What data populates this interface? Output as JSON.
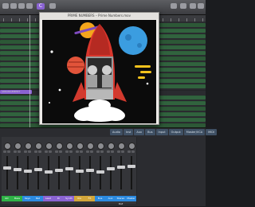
{
  "app": {
    "toolbar_badge": "C"
  },
  "arrange": {
    "tracks": [
      "",
      "",
      "",
      "",
      "",
      "",
      "",
      "",
      "",
      "",
      "",
      "",
      "",
      "",
      "",
      "",
      "",
      "",
      ""
    ],
    "highlight_track_label": "ARRANGEMENT"
  },
  "art_window": {
    "title": "PRIME NUMBERS – Prime Numbers.mov"
  },
  "mixer": {
    "tabs": [
      "Audio",
      "Inst",
      "Aux",
      "Bus",
      "Input",
      "Output",
      "Master/VCA",
      "MIDI"
    ],
    "strip_names": [
      "Gtr",
      "Bass",
      "Keys",
      "Pad",
      "Lead",
      "Dr",
      "Synth",
      "Vox",
      "FX",
      "Bus",
      "Aux",
      "Stereo Out",
      "Master"
    ],
    "strip_colors": [
      "#2fb347",
      "#2fb347",
      "#2b8ae0",
      "#2b8ae0",
      "#8a63d2",
      "#8a63d2",
      "#8a63d2",
      "#d2a63a",
      "#d2a63a",
      "#2b8ae0",
      "#2b8ae0",
      "#2b8ae0",
      "#2b8ae0"
    ],
    "fader_levels": [
      0.68,
      0.62,
      0.58,
      0.62,
      0.55,
      0.6,
      0.64,
      0.58,
      0.6,
      0.55,
      0.66,
      0.7,
      0.72
    ]
  },
  "colors": {
    "accent": "#8a63d2",
    "region_green": "#3bb453",
    "region_purple": "#8a63d2",
    "tab_blue": "#3f5064"
  }
}
